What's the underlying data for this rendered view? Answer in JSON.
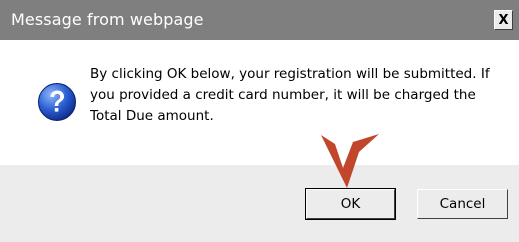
{
  "dialog": {
    "title": "Message from webpage",
    "close_label": "X",
    "message": "By clicking OK below, your registration will be submitted. If you provided a credit card number, it will be charged the Total Due amount.",
    "icon": "question-icon",
    "buttons": {
      "ok_label": "OK",
      "cancel_label": "Cancel"
    },
    "annotation": {
      "icon": "arrow-down-icon",
      "color": "#c1462b"
    }
  }
}
